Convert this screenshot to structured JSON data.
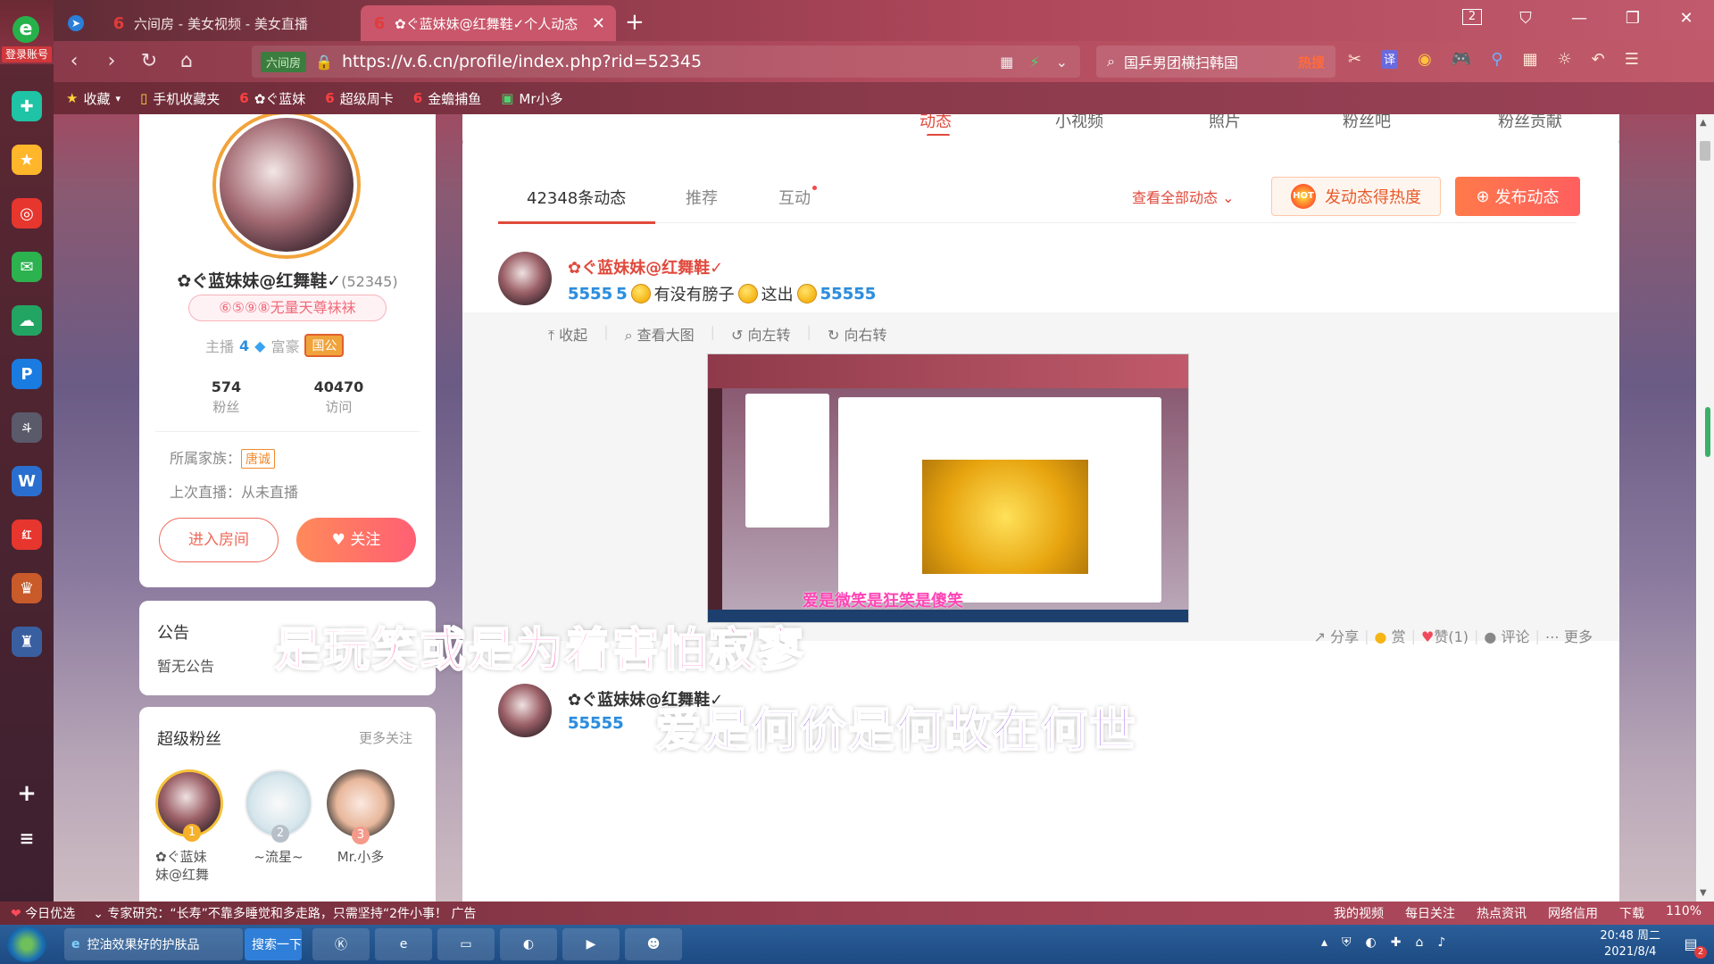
{
  "browser": {
    "login_label": "登录账号",
    "tabs": [
      {
        "label": "",
        "icon": "compass-icon"
      },
      {
        "label": "六间房 - 美女视频 - 美女直播",
        "icon": "six-logo-icon"
      },
      {
        "label": "✿ぐ蓝妹妹@红舞鞋✓个人动态",
        "icon": "six-logo-icon",
        "active": true
      }
    ],
    "new_tab": "+",
    "window_count": "2",
    "address": {
      "badge": "六间房",
      "url": "https://v.6.cn/profile/index.php?rid=52345"
    },
    "search": {
      "query": "国乒男团横扫韩国",
      "hot": "热搜"
    },
    "bookmarks": [
      {
        "label": "收藏"
      },
      {
        "label": "手机收藏夹"
      },
      {
        "label": "✿ぐ蓝妹"
      },
      {
        "label": "超级周卡"
      },
      {
        "label": "金蟾捕鱼"
      },
      {
        "label": "Mr小多"
      }
    ],
    "zoom": "110%"
  },
  "topnav": {
    "items": [
      "动态",
      "小视频",
      "照片",
      "粉丝吧",
      "粉丝贡献"
    ]
  },
  "profile": {
    "name": "✿ぐ蓝妹妹@红舞鞋✓",
    "rid": "(52345)",
    "title": "⑥⑤⑨⑧无量天尊袜袜",
    "anchor_label": "主播",
    "anchor_level": "4",
    "rich_label": "富豪",
    "rich_badge": "国公",
    "fans_count": "574",
    "fans_label": "粉丝",
    "visits_count": "40470",
    "visits_label": "访问",
    "family_label": "所属家族：",
    "family_value": "唐诚",
    "last_live": "上次直播：从未直播",
    "enter_button": "进入房间",
    "follow_button": "关注"
  },
  "notice": {
    "title": "公告",
    "body": "暂无公告"
  },
  "super_fans": {
    "title": "超级粉丝",
    "more": "更多关注",
    "fans": [
      {
        "rank": "1",
        "name": "✿ぐ蓝妹\n妹@红舞"
      },
      {
        "rank": "2",
        "name": "~流星~"
      },
      {
        "rank": "3",
        "name": "Mr.小多"
      }
    ]
  },
  "feed": {
    "tabs": [
      "42348条动态",
      "推荐",
      "互动"
    ],
    "view_all": "查看全部动态",
    "hot_button": "发动态得热度",
    "hot_badge": "HOT",
    "publish_button": "发布动态",
    "post1": {
      "author": "✿ぐ蓝妹妹@红舞鞋✓",
      "text_a": "有没有膀子",
      "text_b": "这出",
      "image_tools": [
        "收起",
        "查看大图",
        "向左转",
        "向右转"
      ],
      "image_caption": "爱是微笑是狂笑是傻笑",
      "actions": [
        "分享",
        "赏",
        "赞(1)",
        "评论",
        "更多"
      ]
    },
    "post2": {
      "author": "✿ぐ蓝妹妹@红舞鞋✓"
    }
  },
  "captions": {
    "line1": "是玩笑或是为着害怕寂寥",
    "line2": "爱是何价是何故在何世"
  },
  "statusbar": {
    "left1": "今日优选",
    "left2": "专家研究：“长寿”不靠多睡觉和多走路，只需坚持“2件小事！",
    "ad": "广告",
    "right": [
      "我的视频",
      "每日关注",
      "热点资讯",
      "网络信用",
      "下载"
    ]
  },
  "taskbar": {
    "search_app": "控油效果好的护肤品",
    "search_btn": "搜索一下",
    "time": "20:48 周二",
    "date": "2021/8/4",
    "badge": "2"
  },
  "colors": {
    "accent": "#e04a3c",
    "follow": "#ff5f73",
    "caption1": "#ff4fb2",
    "caption2": "#8a3bd8"
  }
}
